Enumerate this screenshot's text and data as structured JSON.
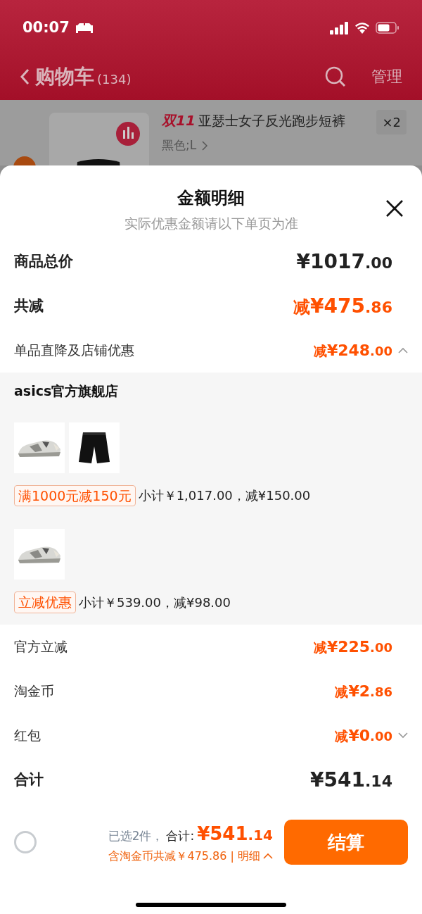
{
  "status_bar": {
    "time": "00:07"
  },
  "nav": {
    "title": "购物车",
    "count": "(134)",
    "action": "管理"
  },
  "cart_item": {
    "checked": true,
    "promo": "双11",
    "title": "亚瑟士女子反光跑步短裤",
    "variant": "黑色;L",
    "quantity": "×2"
  },
  "sheet": {
    "title": "金额明细",
    "subtitle": "实际优惠金额请以下单页为准",
    "top_rows": [
      {
        "label": "商品总价",
        "kind": "price",
        "emphasis": true,
        "prefix": "",
        "amount": "¥1017",
        "decimals": ".00"
      },
      {
        "label": "共减",
        "kind": "deduction",
        "emphasis": true,
        "prefix": "减",
        "amount": "¥475",
        "decimals": ".86"
      },
      {
        "label": "单品直降及店铺优惠",
        "kind": "deduction",
        "emphasis": false,
        "prefix": "减",
        "amount": "¥248",
        "decimals": ".00",
        "expanded": true
      }
    ],
    "detail": {
      "store": "asics官方旗舰店",
      "groups": [
        {
          "tag": "满1000元减150元",
          "summary": "小计￥1,017.00，减¥150.00"
        },
        {
          "tag": "立减优惠",
          "summary": "小计￥539.00，减¥98.00"
        }
      ]
    },
    "bottom_rows": [
      {
        "label": "官方立减",
        "kind": "deduction",
        "emphasis": false,
        "prefix": "减",
        "amount": "¥225",
        "decimals": ".00"
      },
      {
        "label": "淘金币",
        "kind": "deduction",
        "emphasis": false,
        "prefix": "减",
        "amount": "¥2",
        "decimals": ".86"
      },
      {
        "label": "红包",
        "kind": "deduction",
        "emphasis": false,
        "prefix": "减",
        "amount": "¥0",
        "decimals": ".00",
        "expanded": false
      },
      {
        "label": "合计",
        "kind": "price",
        "emphasis": true,
        "prefix": "",
        "amount": "¥541",
        "decimals": ".14"
      }
    ]
  },
  "checkout": {
    "select_all": false,
    "selected": "已选2件，",
    "total_label": "合计:",
    "total": "¥541",
    "total_decimals": ".14",
    "savings": "含淘金币共减￥475.86 | 明细",
    "button": "结算"
  }
}
